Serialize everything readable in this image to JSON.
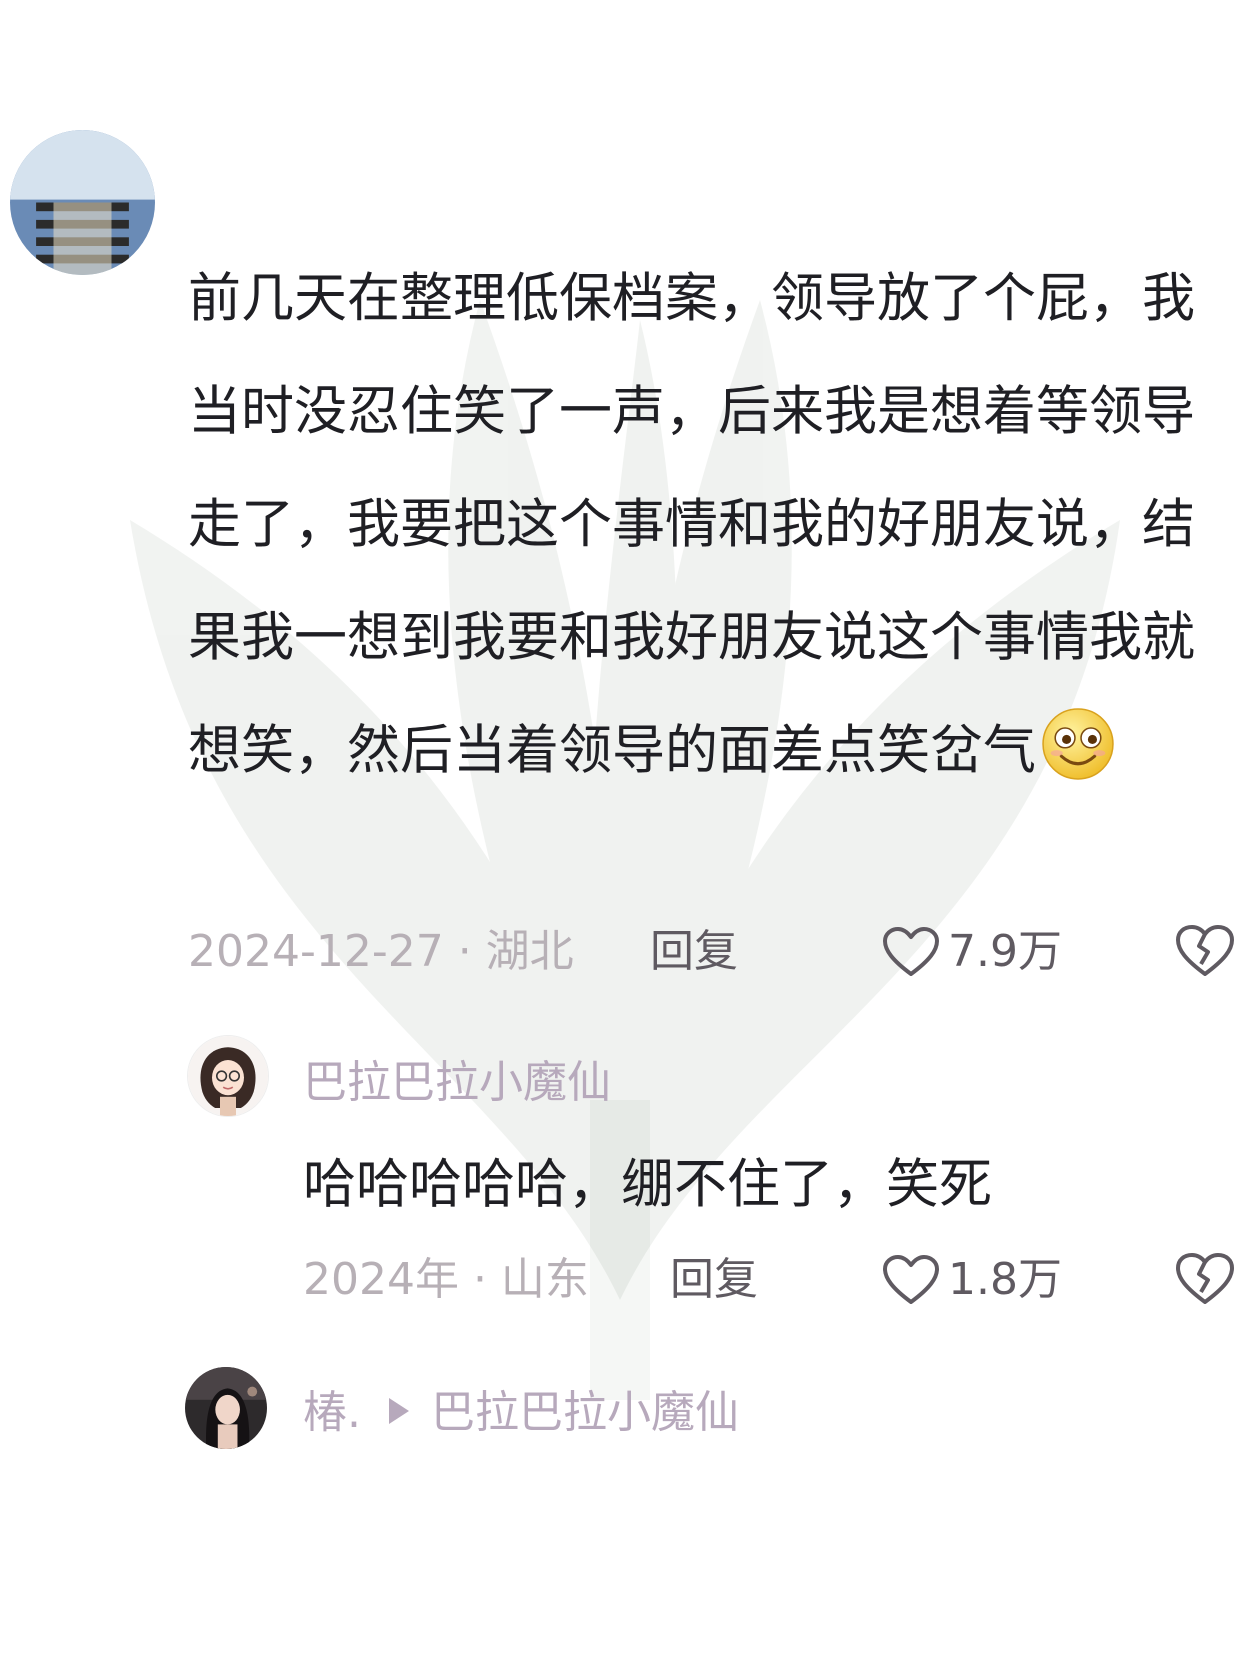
{
  "main_comment": {
    "text": "前几天在整理低保档案，领导放了个屁，我当时没忍住笑了一声，后来我是想着等领导走了，我要把这个事情和我的好朋友说，结果我一想到我要和我好朋友说这个事情我就想笑，然后当着领导的面差点笑岔气",
    "emoji_icon": "smiling-face-emoji-icon",
    "meta": "2024-12-27 · 湖北",
    "reply_label": "回复",
    "likes": "7.9万"
  },
  "reply_comment": {
    "username": "巴拉巴拉小魔仙",
    "text": "哈哈哈哈哈，绷不住了，笑死",
    "meta": "2024年 · 山东",
    "reply_label": "回复",
    "likes": "1.8万"
  },
  "nested_reply": {
    "username": "椿.",
    "reply_to": "巴拉巴拉小魔仙"
  },
  "colors": {
    "text": "#1f1f24",
    "meta": "#b7b0b6",
    "username": "#b7a9bc",
    "icon": "#5f5a61"
  }
}
